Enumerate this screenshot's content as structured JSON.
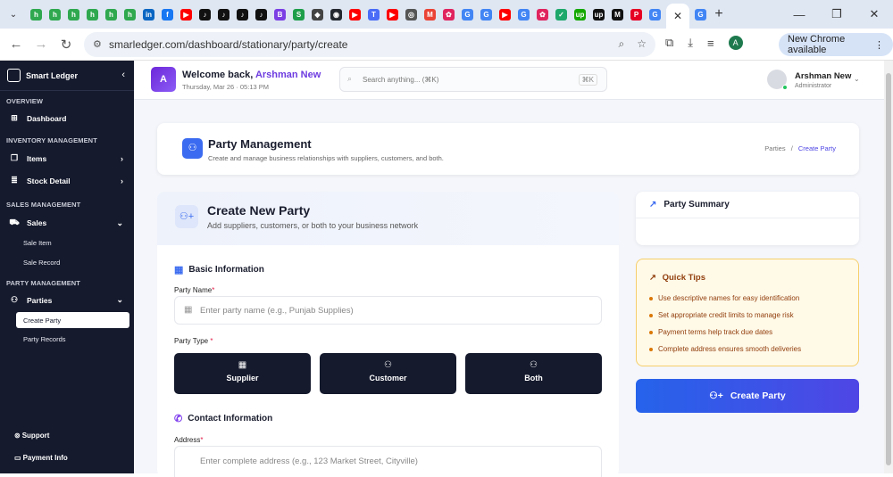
{
  "browser": {
    "url": "smarledger.com/dashboard/stationary/party/create",
    "new_chrome": "New Chrome available",
    "profile_initial": "A",
    "tab_icons": [
      {
        "label": "h",
        "color": "#2fa84f"
      },
      {
        "label": "h",
        "color": "#2fa84f"
      },
      {
        "label": "h",
        "color": "#2fa84f"
      },
      {
        "label": "h",
        "color": "#2fa84f"
      },
      {
        "label": "h",
        "color": "#2fa84f"
      },
      {
        "label": "h",
        "color": "#2fa84f"
      },
      {
        "label": "in",
        "color": "#0a66c2"
      },
      {
        "label": "f",
        "color": "#1877f2"
      },
      {
        "label": "▶",
        "color": "#ff0000"
      },
      {
        "label": "♪",
        "color": "#111111"
      },
      {
        "label": "♪",
        "color": "#111111"
      },
      {
        "label": "♪",
        "color": "#111111"
      },
      {
        "label": "♪",
        "color": "#111111"
      },
      {
        "label": "B",
        "color": "#7b3fe4"
      },
      {
        "label": "S",
        "color": "#1e9e4a"
      },
      {
        "label": "◆",
        "color": "#444444"
      },
      {
        "label": "◉",
        "color": "#24292f"
      },
      {
        "label": "▶",
        "color": "#ff0000"
      },
      {
        "label": "T",
        "color": "#4a6cf7"
      },
      {
        "label": "▶",
        "color": "#ff0000"
      },
      {
        "label": "◎",
        "color": "#555555"
      },
      {
        "label": "M",
        "color": "#ea4335"
      },
      {
        "label": "✿",
        "color": "#e0245e"
      },
      {
        "label": "G",
        "color": "#4285f4"
      },
      {
        "label": "G",
        "color": "#4285f4"
      },
      {
        "label": "▶",
        "color": "#ff0000"
      },
      {
        "label": "G",
        "color": "#4285f4"
      },
      {
        "label": "✿",
        "color": "#e0245e"
      },
      {
        "label": "✓",
        "color": "#1fa86b"
      },
      {
        "label": "up",
        "color": "#14a800"
      },
      {
        "label": "up",
        "color": "#111111"
      },
      {
        "label": "M",
        "color": "#111111"
      },
      {
        "label": "P",
        "color": "#e60023"
      },
      {
        "label": "G",
        "color": "#4285f4"
      }
    ]
  },
  "sidebar": {
    "app_name": "Smart Ledger",
    "sections": {
      "overview": "OVERVIEW",
      "inventory": "INVENTORY MANAGEMENT",
      "sales": "SALES MANAGEMENT",
      "party": "PARTY MANAGEMENT"
    },
    "items": {
      "dashboard": "Dashboard",
      "items": "Items",
      "stock_detail": "Stock Detail",
      "sales": "Sales",
      "sale_item": "Sale Item",
      "sale_record": "Sale Record",
      "parties": "Parties",
      "create_party": "Create Party",
      "party_records": "Party Records"
    },
    "footer": {
      "support": "Support",
      "payment_info": "Payment Info"
    }
  },
  "topbar": {
    "avatar_initial": "A",
    "welcome_prefix": "Welcome back,",
    "user_first": "Arshman New",
    "date": "Thursday, Mar 26",
    "time": "05:13 PM",
    "search_placeholder": "Search anything... (⌘K)",
    "search_kbd": "⌘K",
    "user_name": "Arshman New",
    "user_role": "Administrator"
  },
  "page_header": {
    "title": "Party Management",
    "subtitle": "Create and manage business relationships with suppliers, customers, and both.",
    "breadcrumb_parent": "Parties",
    "breadcrumb_sep": "/",
    "breadcrumb_current": "Create Party"
  },
  "form": {
    "title": "Create New Party",
    "subtitle": "Add suppliers, customers, or both to your business network",
    "basic_section": "Basic Information",
    "party_name_label": "Party Name",
    "party_name_placeholder": "Enter party name (e.g., Punjab Supplies)",
    "party_type_label": "Party Type",
    "types": [
      "Supplier",
      "Customer",
      "Both"
    ],
    "contact_section": "Contact Information",
    "address_label": "Address",
    "address_placeholder": "Enter complete address (e.g., 123 Market Street, Cityville)",
    "required_mark": "*"
  },
  "summary": {
    "title": "Party Summary"
  },
  "tips": {
    "title": "Quick Tips",
    "items": [
      "Use descriptive names for easy identification",
      "Set appropriate credit limits to manage risk",
      "Payment terms help track due dates",
      "Complete address ensures smooth deliveries"
    ]
  },
  "actions": {
    "create_party": "Create Party"
  }
}
